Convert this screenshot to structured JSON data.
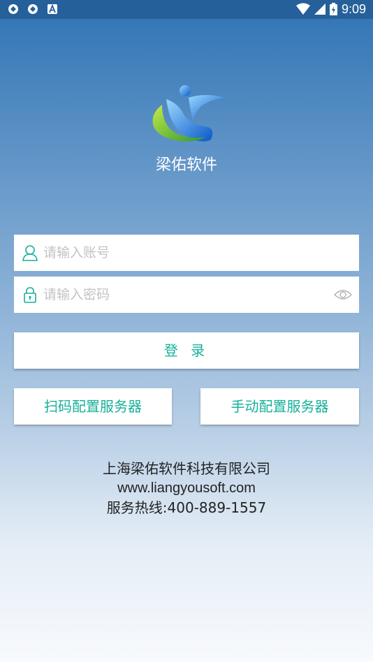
{
  "status_bar": {
    "time": "9:09",
    "left_icons": [
      "sync-icon",
      "sync-icon",
      "font-a-icon"
    ],
    "right_icons": [
      "wifi-icon",
      "signal-icon",
      "battery-icon"
    ]
  },
  "app": {
    "name": "梁佑软件",
    "logo_icon": "liangyou-logo-icon"
  },
  "login_form": {
    "account_placeholder": "请输入账号",
    "account_value": "",
    "password_placeholder": "请输入密码",
    "password_value": "",
    "login_label": "登 录"
  },
  "config_buttons": {
    "scan_label": "扫码配置服务器",
    "manual_label": "手动配置服务器"
  },
  "footer": {
    "company": "上海梁佑软件科技有限公司",
    "website": "www.liangyousoft.com",
    "hotline": "服务热线:400-889-1557"
  },
  "colors": {
    "accent": "#16b09a",
    "status_bar": "#25609a",
    "gradient_top": "#2f73b4",
    "gradient_bottom": "#f8fafd"
  }
}
